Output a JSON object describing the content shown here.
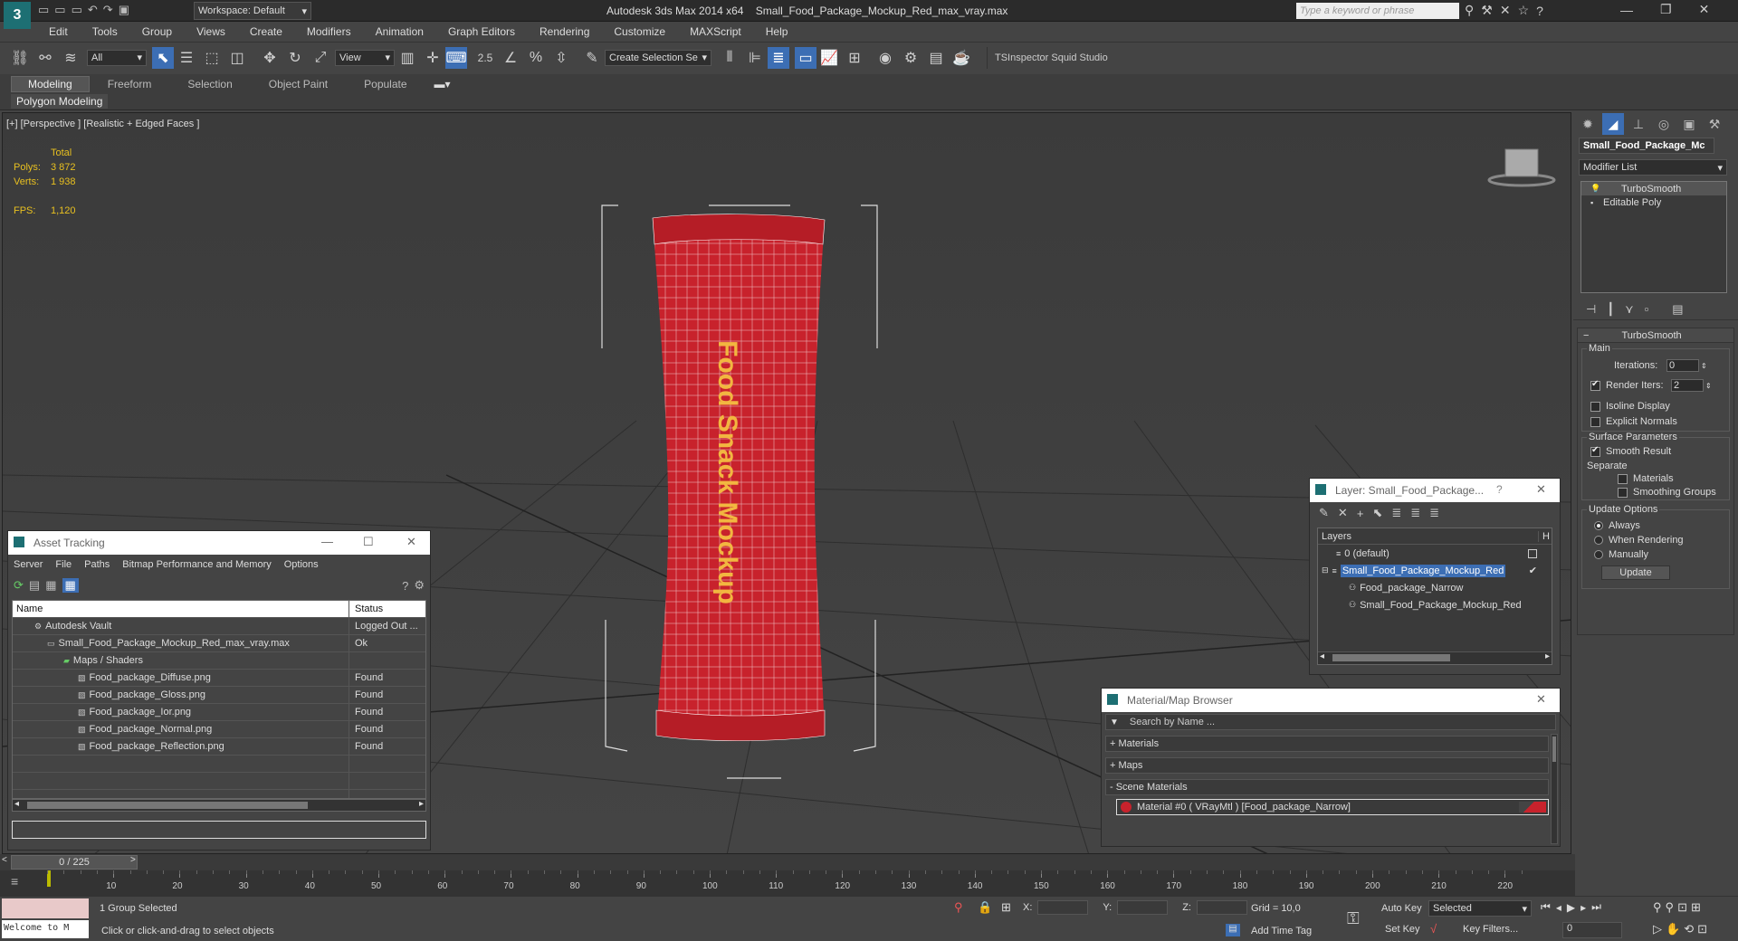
{
  "titlebar": {
    "workspace": "Workspace: Default",
    "app": "Autodesk 3ds Max  2014 x64",
    "file": "Small_Food_Package_Mockup_Red_max_vray.max",
    "search_placeholder": "Type a keyword or phrase"
  },
  "menu": [
    "Edit",
    "Tools",
    "Group",
    "Views",
    "Create",
    "Modifiers",
    "Animation",
    "Graph Editors",
    "Rendering",
    "Customize",
    "MAXScript",
    "Help"
  ],
  "toolbar": {
    "filter": "All",
    "refcoord": "View",
    "selset": "Create Selection Se",
    "snap": "2.5",
    "plugins": "TSInspector  Squid Studio v"
  },
  "ribbon": {
    "tabs": [
      "Modeling",
      "Freeform",
      "Selection",
      "Object Paint",
      "Populate"
    ],
    "sub": "Polygon Modeling"
  },
  "viewport": {
    "label": "[+] [Perspective ] [Realistic + Edged Faces ]",
    "stats": {
      "total": "Total",
      "polys_l": "Polys:",
      "polys": "3 872",
      "verts_l": "Verts:",
      "verts": "1 938",
      "fps_l": "FPS:",
      "fps": "1,120"
    },
    "package_text": "Food Snack Mockup"
  },
  "cmd": {
    "object": "Small_Food_Package_Mc",
    "modlist": "Modifier List",
    "stack": [
      "TurboSmooth",
      "Editable Poly"
    ],
    "rollout": "TurboSmooth",
    "main": "Main",
    "iter_l": "Iterations:",
    "iter": "0",
    "render_l": "Render Iters:",
    "render": "2",
    "isoline": "Isoline Display",
    "explicit": "Explicit Normals",
    "surface": "Surface Parameters",
    "smooth": "Smooth Result",
    "separate": "Separate",
    "materials": "Materials",
    "smgroups": "Smoothing Groups",
    "update_opts": "Update Options",
    "always": "Always",
    "whenr": "When Rendering",
    "manually": "Manually",
    "update_btn": "Update"
  },
  "asset": {
    "title": "Asset Tracking",
    "menu": [
      "Server",
      "File",
      "Paths",
      "Bitmap Performance and Memory",
      "Options"
    ],
    "col_name": "Name",
    "col_status": "Status",
    "rows": [
      {
        "n": "Autodesk Vault",
        "s": "Logged Out ...",
        "i": 1
      },
      {
        "n": "Small_Food_Package_Mockup_Red_max_vray.max",
        "s": "Ok",
        "i": 2
      },
      {
        "n": "Maps / Shaders",
        "s": "",
        "i": 3
      },
      {
        "n": "Food_package_Diffuse.png",
        "s": "Found",
        "i": 4
      },
      {
        "n": "Food_package_Gloss.png",
        "s": "Found",
        "i": 4
      },
      {
        "n": "Food_package_Ior.png",
        "s": "Found",
        "i": 4
      },
      {
        "n": "Food_package_Normal.png",
        "s": "Found",
        "i": 4
      },
      {
        "n": "Food_package_Reflection.png",
        "s": "Found",
        "i": 4
      }
    ]
  },
  "layer": {
    "title": "Layer: Small_Food_Package...",
    "help": "?",
    "col": "Layers",
    "col2": "H",
    "items": [
      "0 (default)",
      "Small_Food_Package_Mockup_Red",
      "Food_package_Narrow",
      "Small_Food_Package_Mockup_Red"
    ]
  },
  "matbrowser": {
    "title": "Material/Map Browser",
    "search": "Search by Name ...",
    "materials": "+ Materials",
    "maps": "+ Maps",
    "scene": "- Scene Materials",
    "item": "Material #0  ( VRayMtl )  [Food_package_Narrow]"
  },
  "timeline": {
    "frame": "0 / 225",
    "ticks": [
      "10",
      "20",
      "30",
      "40",
      "50",
      "60",
      "70",
      "80",
      "90",
      "100",
      "110",
      "120",
      "130",
      "140",
      "150",
      "160",
      "170",
      "180",
      "190",
      "200",
      "210",
      "220"
    ]
  },
  "status": {
    "welcome": "Welcome to M",
    "selected": "1 Group Selected",
    "prompt": "Click or click-and-drag to select objects",
    "x": "X:",
    "y": "Y:",
    "z": "Z:",
    "grid": "Grid = 10,0",
    "addtime": "Add Time Tag",
    "autokey": "Auto Key",
    "setkey": "Set Key",
    "keymode": "Selected",
    "keyfilters": "Key Filters...",
    "curframe": "0"
  }
}
